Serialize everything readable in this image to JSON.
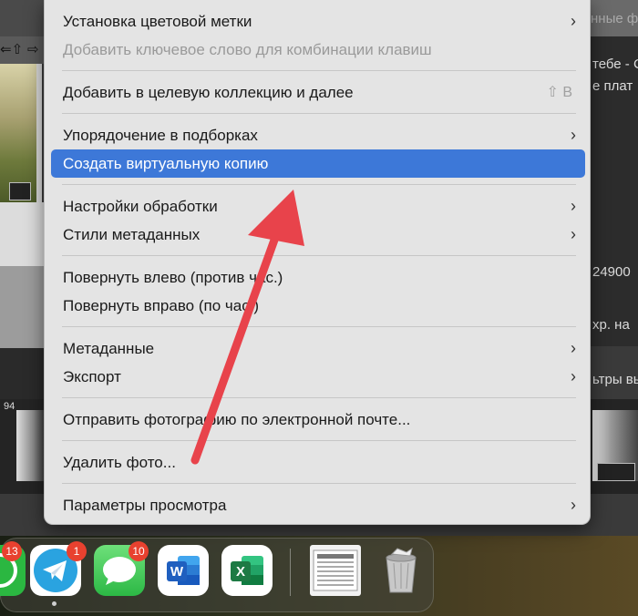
{
  "menu": {
    "items": [
      {
        "label": "Установка цветовой метки",
        "submenu": true
      },
      {
        "label": "Добавить ключевое слово для комбинации клавиш",
        "disabled": true
      },
      {
        "label": "Добавить в целевую коллекцию и далее",
        "shortcut": "⇧ B"
      },
      {
        "label": "Упорядочение в подборках",
        "submenu": true
      },
      {
        "label": "Создать виртуальную копию",
        "selected": true
      },
      {
        "label": "Настройки обработки",
        "submenu": true
      },
      {
        "label": "Стили метаданных",
        "submenu": true
      },
      {
        "label": "Повернуть влево (против час.)"
      },
      {
        "label": "Повернуть вправо (по час.)"
      },
      {
        "label": "Метаданные",
        "submenu": true
      },
      {
        "label": "Экспорт",
        "submenu": true
      },
      {
        "label": "Отправить фотографию по электронной почте..."
      },
      {
        "label": "Удалить фото..."
      },
      {
        "label": "Параметры просмотра",
        "submenu": true
      }
    ],
    "chevron": "›"
  },
  "background": {
    "right_top": "нные ф",
    "right_lines": [
      "тебе - С",
      "е плат",
      "24900",
      "хр. на",
      "ьтры вы"
    ],
    "film_number": "94",
    "left_toolbar": [
      "⇐⇧",
      "⇨"
    ]
  },
  "dock": {
    "apps": [
      {
        "name": "WhatsApp",
        "icon": "whatsapp-icon",
        "badge": "13",
        "color": "#2bb741"
      },
      {
        "name": "Telegram",
        "icon": "telegram-icon",
        "badge": "1",
        "color": "#2aa3e0"
      },
      {
        "name": "Messages",
        "icon": "messages-icon",
        "badge": "10",
        "color": "#34c759"
      },
      {
        "name": "Word",
        "icon": "word-icon",
        "letter": "W",
        "color": "#1f5fbf"
      },
      {
        "name": "Excel",
        "icon": "excel-icon",
        "letter": "X",
        "color": "#1d7a44"
      },
      {
        "name": "Document",
        "icon": "document-thumbnail-icon"
      },
      {
        "name": "Trash",
        "icon": "trash-icon"
      }
    ]
  },
  "annotation": {
    "arrow_color": "#e8434b"
  }
}
